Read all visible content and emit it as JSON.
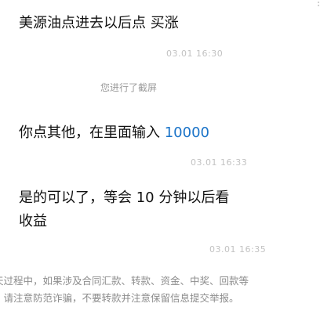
{
  "messages": [
    {
      "text": "美源油点进去以后点  买涨",
      "time": "03.01 16:30"
    },
    {
      "system": "您进行了截屏"
    },
    {
      "text_prefix": "你点其他，在里面输入 ",
      "text_number": "10000",
      "time": "03.01 16:33"
    },
    {
      "line1": "是的可以了，等会 10 分钟以后看",
      "line2": "收益",
      "time": "03.01 16:35"
    }
  ],
  "notice": {
    "line1": "天过程中，如果涉及合同汇款、转款、资金、中奖、回款等",
    "line2": "，请注意防范诈骗，不要转款并注意保留信息提交举报。"
  },
  "colors": {
    "link_number": "#1a73c8",
    "timestamp": "#c2c2c2",
    "notice_text": "#8c8c8c"
  },
  "icons": {
    "more": "vertical-dots-icon"
  }
}
